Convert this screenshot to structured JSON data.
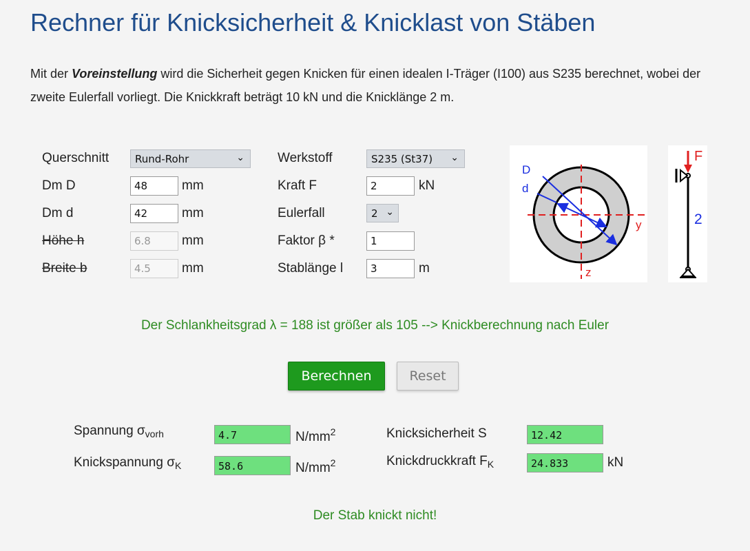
{
  "page": {
    "title": "Rechner für Knicksicherheit & Knicklast von Stäben",
    "intro_before": "Mit der ",
    "intro_bold": "Voreinstellung",
    "intro_after": " wird die Sicherheit gegen Knicken für einen idealen I-Träger (I100) aus S235 berechnet, wobei der zweite Eulerfall vorliegt. Die Knickkraft beträgt 10 kN und die Knicklänge 2 m."
  },
  "form": {
    "querschnitt_label": "Querschnitt",
    "querschnitt_value": "Rund-Rohr",
    "dmD_label": "Dm D",
    "dmD_value": "48",
    "dmD_unit": "mm",
    "dmd_label": "Dm d",
    "dmd_value": "42",
    "dmd_unit": "mm",
    "hoehe_label": "Höhe h",
    "hoehe_value": "6.8",
    "hoehe_unit": "mm",
    "breite_label": "Breite b",
    "breite_value": "4.5",
    "breite_unit": "mm",
    "werkstoff_label": "Werkstoff",
    "werkstoff_value": "S235 (St37)",
    "kraft_label": "Kraft F",
    "kraft_value": "2",
    "kraft_unit": "kN",
    "eulerfall_label": "Eulerfall",
    "eulerfall_value": "2",
    "faktor_label": "Faktor β *",
    "faktor_value": "1",
    "stablaenge_label": "Stablänge l",
    "stablaenge_value": "3",
    "stablaenge_unit": "m"
  },
  "diagram": {
    "label_D": "D",
    "label_d": "d",
    "label_y": "y",
    "label_z": "z",
    "label_F": "F",
    "label_case": "2"
  },
  "status": {
    "slenderness": "Der Schlankheitsgrad λ = 188 ist größer als 105 --> Knickberechnung nach Euler",
    "result": "Der Stab knickt nicht!"
  },
  "buttons": {
    "calculate": "Berechnen",
    "reset": "Reset"
  },
  "results": {
    "spannung_label": "Spannung σ",
    "spannung_sub": "vorh",
    "spannung_value": "4.7",
    "spannung_unit": "N/mm",
    "spannung_unit_sup": "2",
    "knickspannung_label": "Knickspannung σ",
    "knickspannung_sub": "K",
    "knickspannung_value": "58.6",
    "knickspannung_unit": "N/mm",
    "knickspannung_unit_sup": "2",
    "sicherheit_label": "Knicksicherheit S",
    "sicherheit_value": "12.42",
    "knickkraft_label": "Knickdruckkraft F",
    "knickkraft_sub": "K",
    "knickkraft_value": "24.833",
    "knickkraft_unit": "kN"
  },
  "colors": {
    "title": "#1f4d8c",
    "success": "#2e8b22",
    "button": "#1e9a1e",
    "output": "#6ee07e"
  }
}
